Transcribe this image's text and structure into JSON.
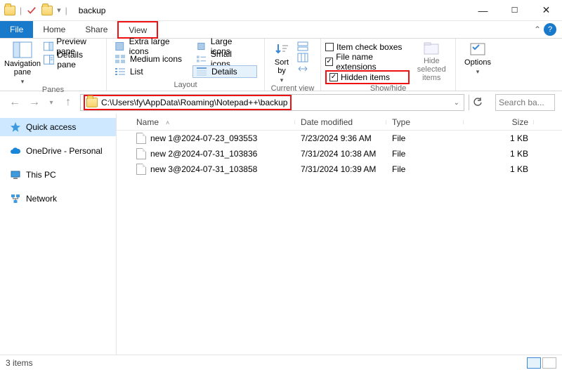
{
  "title": "backup",
  "tabs": {
    "file": "File",
    "home": "Home",
    "share": "Share",
    "view": "View"
  },
  "ribbon": {
    "panes": {
      "nav": "Navigation\npane",
      "preview": "Preview pane",
      "details": "Details pane",
      "label": "Panes"
    },
    "layout": {
      "xl": "Extra large icons",
      "lg": "Large icons",
      "md": "Medium icons",
      "sm": "Small icons",
      "list": "List",
      "det": "Details",
      "label": "Layout"
    },
    "currentview": {
      "sort": "Sort\nby",
      "label": "Current view"
    },
    "showhide": {
      "itemcb": "Item check boxes",
      "ext": "File name extensions",
      "hidden": "Hidden items",
      "hidesel": "Hide selected\nitems",
      "label": "Show/hide"
    },
    "options": "Options"
  },
  "address": {
    "path": "C:\\Users\\fy\\AppData\\Roaming\\Notepad++\\backup"
  },
  "search": {
    "placeholder": "Search ba..."
  },
  "columns": {
    "name": "Name",
    "date": "Date modified",
    "type": "Type",
    "size": "Size"
  },
  "files": [
    {
      "name": "new 1@2024-07-23_093553",
      "date": "7/23/2024 9:36 AM",
      "type": "File",
      "size": "1 KB"
    },
    {
      "name": "new 2@2024-07-31_103836",
      "date": "7/31/2024 10:38 AM",
      "type": "File",
      "size": "1 KB"
    },
    {
      "name": "new 3@2024-07-31_103858",
      "date": "7/31/2024 10:39 AM",
      "type": "File",
      "size": "1 KB"
    }
  ],
  "sidebar": {
    "quick": "Quick access",
    "onedrive": "OneDrive - Personal",
    "thispc": "This PC",
    "network": "Network"
  },
  "status": {
    "count": "3 items"
  },
  "checkbox_states": {
    "itemcb": false,
    "ext": true,
    "hidden": true
  }
}
